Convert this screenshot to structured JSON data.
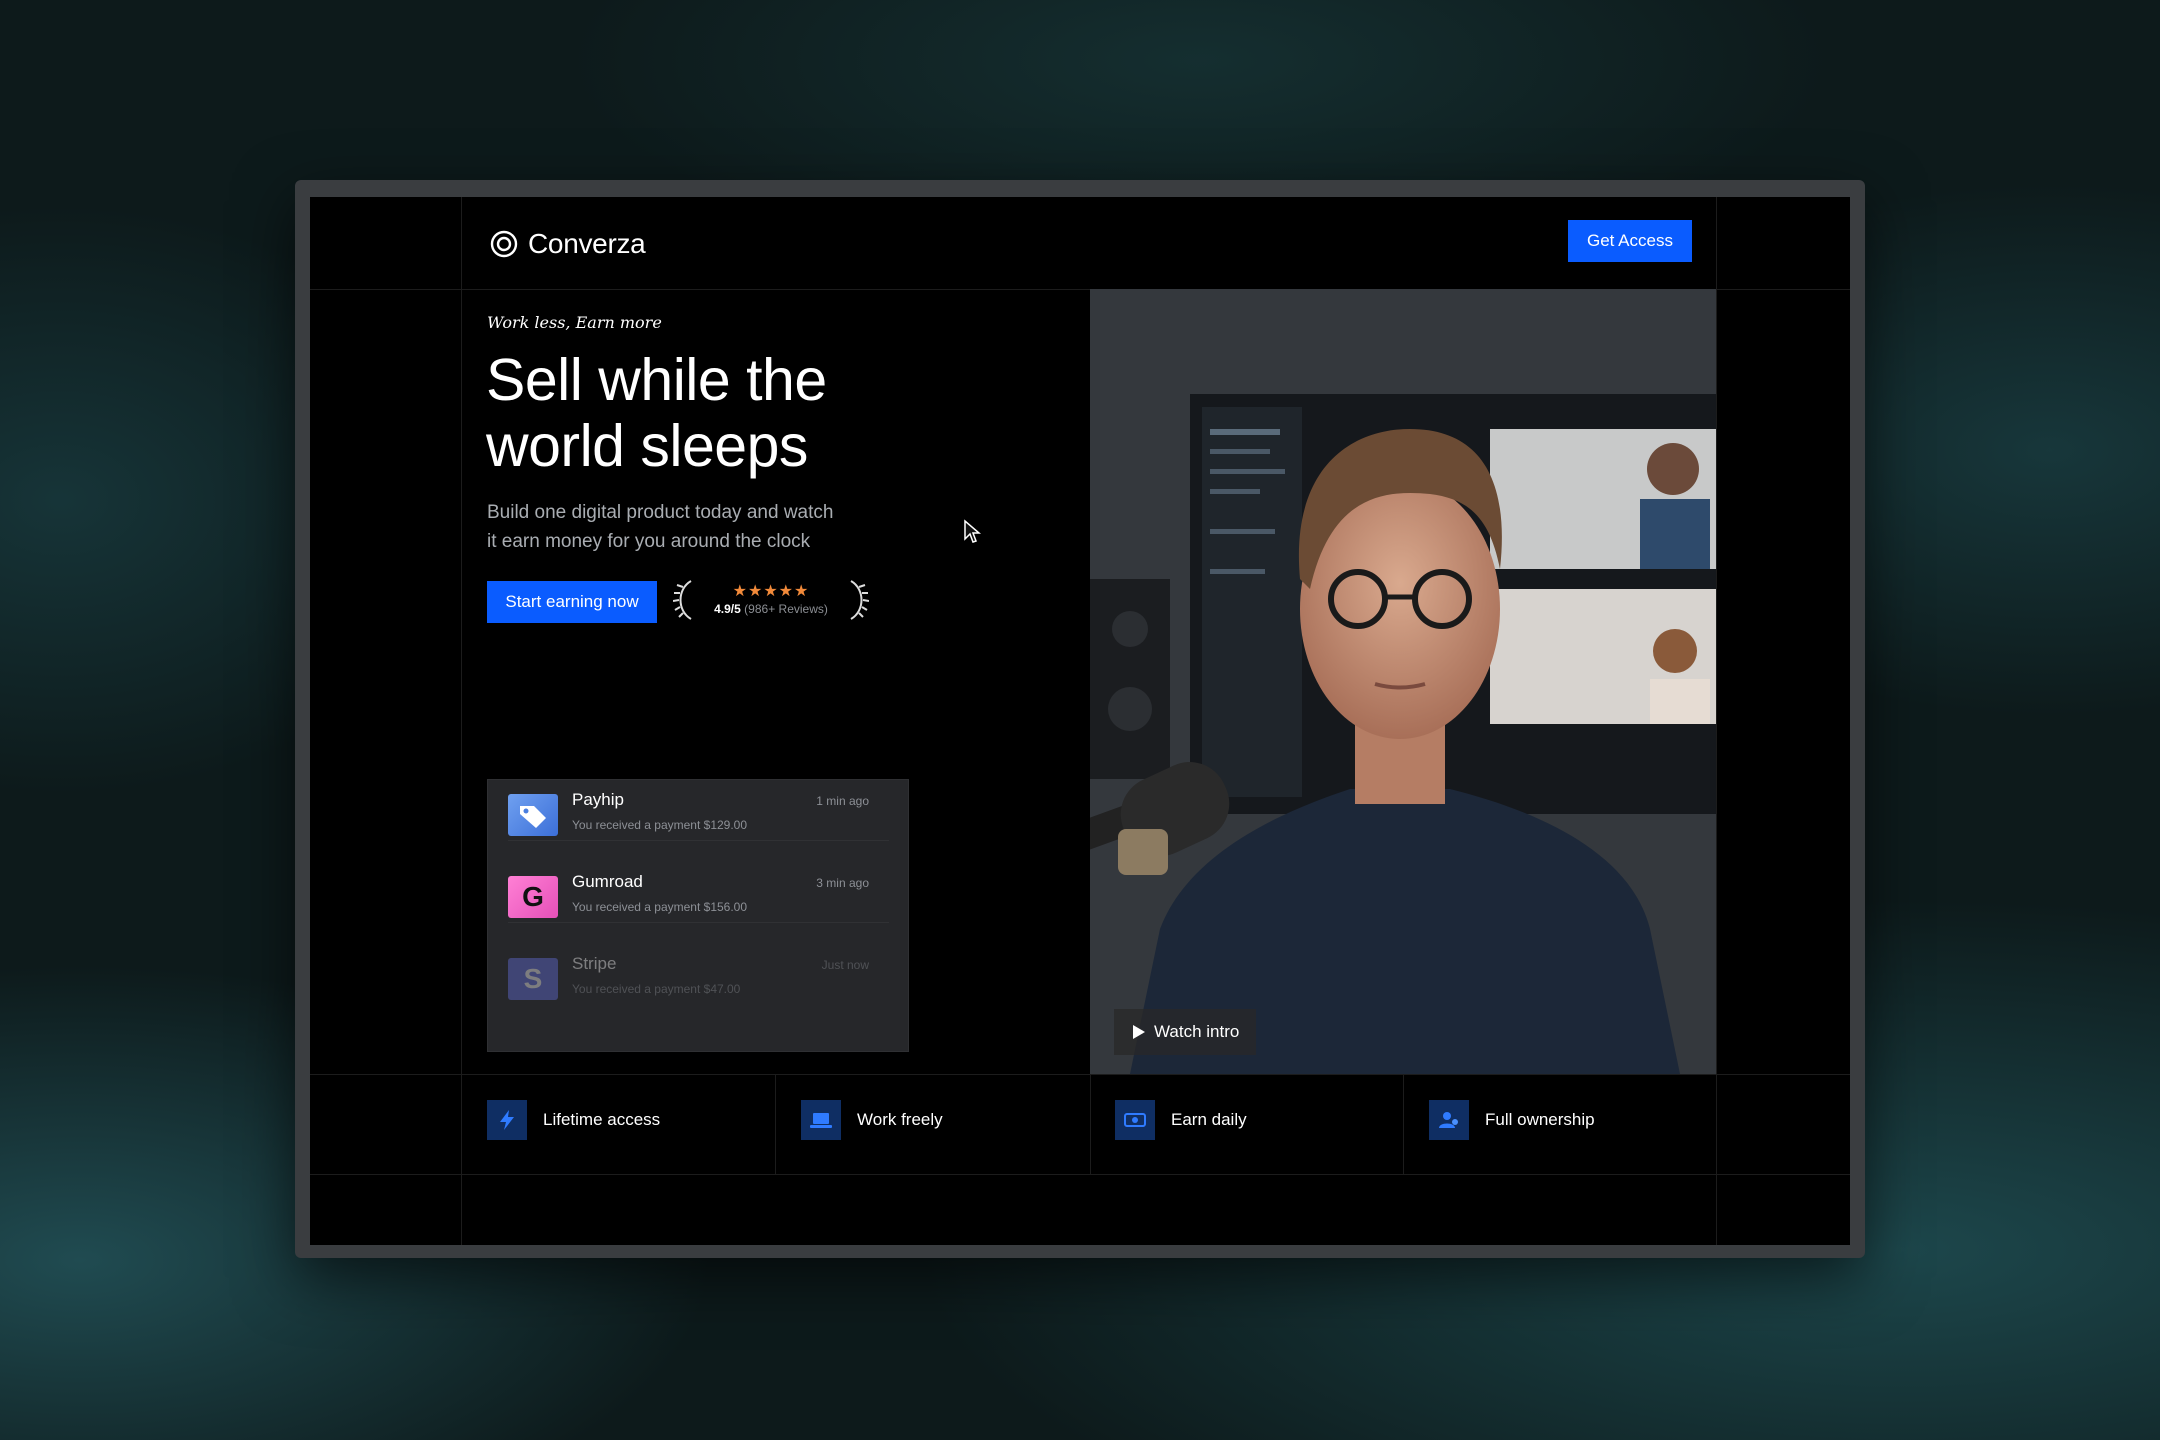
{
  "header": {
    "brand": "Converza",
    "cta_label": "Get Access"
  },
  "hero": {
    "eyebrow": "Work less, Earn more",
    "headline_line1": "Sell while the",
    "headline_line2": "world sleeps",
    "subtitle_line1": "Build one digital product today and watch",
    "subtitle_line2": "it earn money for you around the clock",
    "cta_label": "Start earning now",
    "rating": {
      "stars": "★★★★★",
      "score": "4.9/5",
      "reviews": "(986+ Reviews)"
    }
  },
  "notifications": [
    {
      "title": "Payhip",
      "message": "You received a payment $129.00",
      "time": "1 min ago",
      "icon": "tag-icon",
      "icon_letter": ""
    },
    {
      "title": "Gumroad",
      "message": "You received a payment $156.00",
      "time": "3 min ago",
      "icon": "gumroad-logo",
      "icon_letter": "G"
    },
    {
      "title": "Stripe",
      "message": "You received a payment $47.00",
      "time": "Just now",
      "icon": "stripe-logo",
      "icon_letter": "S"
    }
  ],
  "video": {
    "watch_label": "Watch intro"
  },
  "features": [
    {
      "label": "Lifetime access",
      "icon": "bolt-icon"
    },
    {
      "label": "Work freely",
      "icon": "laptop-icon"
    },
    {
      "label": "Earn daily",
      "icon": "cash-icon"
    },
    {
      "label": "Full ownership",
      "icon": "user-icon"
    }
  ],
  "colors": {
    "accent": "#0a5cff",
    "star": "#f28a3a",
    "feature_icon_bg": "#0f2e63"
  }
}
